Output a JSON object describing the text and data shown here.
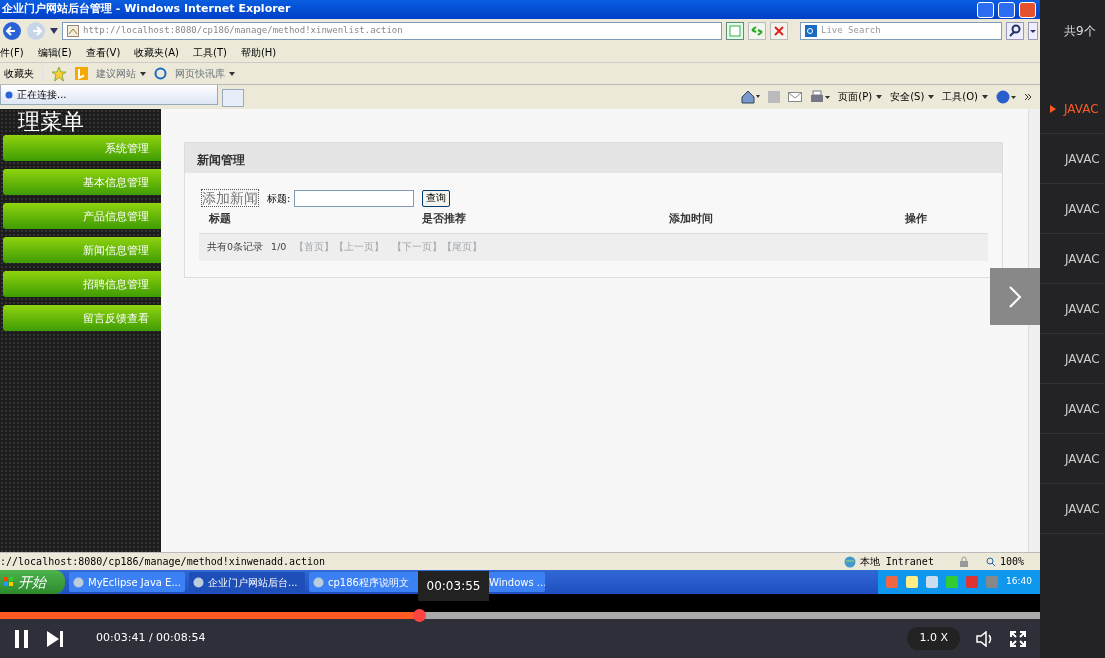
{
  "browser": {
    "title": "企业门户网站后台管理 - Windows Internet Explorer",
    "address": "http://localhost:8080/cp186/manage/method!xinwenlist.action",
    "search_placeholder": "Live Search",
    "menus": [
      "件(F)",
      "编辑(E)",
      "查看(V)",
      "收藏夹(A)",
      "工具(T)",
      "帮助(H)"
    ],
    "favorites": {
      "label": "收藏夹",
      "links": [
        "建议网站",
        "网页快讯库"
      ]
    },
    "tab": "正在连接...",
    "commands": [
      "页面(P)",
      "安全(S)",
      "工具(O)"
    ],
    "status_url": "://localhost:8080/cp186/manage/method!xinwenadd.action",
    "zone": "本地 Intranet",
    "zoom": "100%"
  },
  "page": {
    "menu_title": "理菜单",
    "menu_items": [
      "系统管理",
      "基本信息管理",
      "产品信息管理",
      "新闻信息管理",
      "招聘信息管理",
      "留言反馈查看"
    ],
    "panel_title": "新闻管理",
    "add_link": "添加新闻",
    "search_label": "标题:",
    "search_button": "查询",
    "columns": [
      "标题",
      "是否推荐",
      "添加时间",
      "操作"
    ],
    "footer": {
      "count": "共有0条记录",
      "pages": "1/0",
      "links": [
        "【首页】",
        "【上一页】",
        "【下一页】",
        "【尾页】"
      ]
    }
  },
  "taskbar": {
    "start": "开始",
    "tasks": [
      {
        "label": "MyEclipse Java E...",
        "selected": false
      },
      {
        "label": "企业门户网站后台...",
        "selected": true
      },
      {
        "label": "cp186程序说明文",
        "selected": false
      },
      {
        "label": "Windows ...",
        "selected": false
      }
    ],
    "clock": "16:40"
  },
  "player": {
    "tooltip": "00:03:55",
    "progress": {
      "level": 0.404
    },
    "time": "00:03:41 / 00:08:54",
    "speed": "1.0 X"
  },
  "playlist": {
    "count": "共9个",
    "items": [
      {
        "label": "JAVAC",
        "selected": true
      },
      {
        "label": "JAVAC",
        "selected": false
      },
      {
        "label": "JAVAC",
        "selected": false
      },
      {
        "label": "JAVAC",
        "selected": false
      },
      {
        "label": "JAVAC",
        "selected": false
      },
      {
        "label": "JAVAC",
        "selected": false
      },
      {
        "label": "JAVAC",
        "selected": false
      },
      {
        "label": "JAVAC",
        "selected": false
      },
      {
        "label": "JAVAC",
        "selected": false
      }
    ]
  }
}
